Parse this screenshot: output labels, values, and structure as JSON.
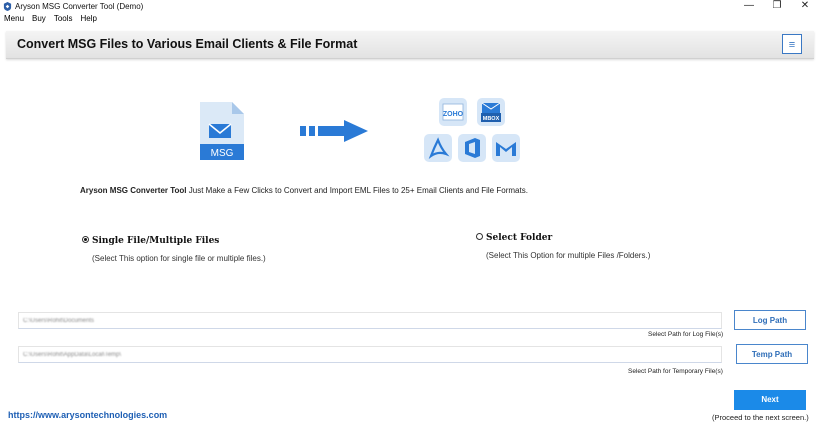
{
  "window": {
    "title": "Aryson MSG Converter Tool (Demo)",
    "controls": {
      "minimize": "—",
      "restore": "❐",
      "close": "✕"
    }
  },
  "menu": [
    "Menu",
    "Buy",
    "Tools",
    "Help"
  ],
  "header": {
    "title": "Convert MSG Files to Various Email Clients & File Format",
    "menu_glyph": "≡"
  },
  "illustration": {
    "source_label": "MSG",
    "targets": {
      "zoho": "ZOHO",
      "mbox": "MBOX"
    }
  },
  "description": {
    "brand": "Aryson MSG Converter Tool",
    "text": " Just Make a Few Clicks to Convert and Import EML Files to 25+ Email Clients and File Formats."
  },
  "options": {
    "single": {
      "label": "Single File/Multiple Files",
      "hint": "(Select This option for single file or multiple files.)",
      "selected": true
    },
    "folder": {
      "label": "Select Folder",
      "hint": "(Select This Option for multiple Files /Folders.)",
      "selected": false
    }
  },
  "log_path": {
    "value": "C:\\Users\\Rohit\\Documents",
    "button": "Log Path",
    "caption": "Select Path for Log File(s)"
  },
  "temp_path": {
    "value": "C:\\Users\\Rohit\\AppData\\Local\\Temp\\",
    "button": "Temp Path",
    "caption": "Select Path for Temporary File(s)"
  },
  "footer": {
    "url": "https://www.arysontechnologies.com",
    "next": "Next",
    "proceed": "(Proceed to the next screen.)"
  },
  "colors": {
    "accent": "#1b8ae8",
    "link": "#1e5fb4",
    "icon_blue": "#2a7ad6"
  }
}
